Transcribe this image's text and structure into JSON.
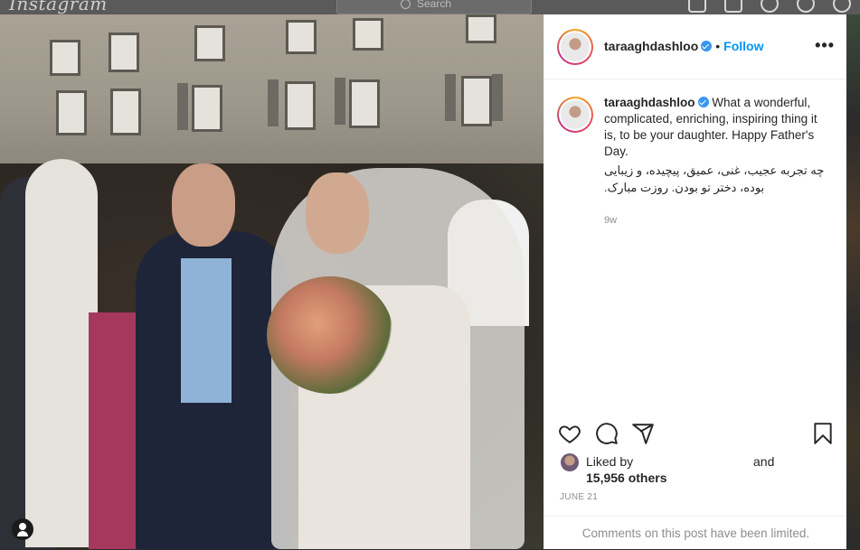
{
  "topbar": {
    "logo": "Instagram",
    "search_placeholder": "Search",
    "icons": [
      "home-icon",
      "direct-icon",
      "explore-icon",
      "heart-icon",
      "profile-avatar"
    ]
  },
  "post": {
    "author": "taraaghdashloo",
    "verified": true,
    "separator": "•",
    "follow_label": "Follow",
    "more_label": "•••",
    "caption_en": "What a wonderful, complicated, enriching, inspiring thing it is, to be your daughter. Happy Father's Day.",
    "caption_fa_1": "چه تجربه عجیب، غنی، عمیق، پیچیده، و زیبایی",
    "caption_fa_2": "بوده، دختر تو بودن. روزت مبارک.",
    "time_ago": "9w",
    "liked_by_prefix": "Liked by",
    "liked_by_and": "and",
    "others": "15,956 others",
    "date": "JUNE 21",
    "comments_notice": "Comments on this post have been limited."
  },
  "colors": {
    "accent": "#0095f6",
    "verified": "#3897f0",
    "text": "#262626",
    "muted": "#8e8e8e"
  }
}
